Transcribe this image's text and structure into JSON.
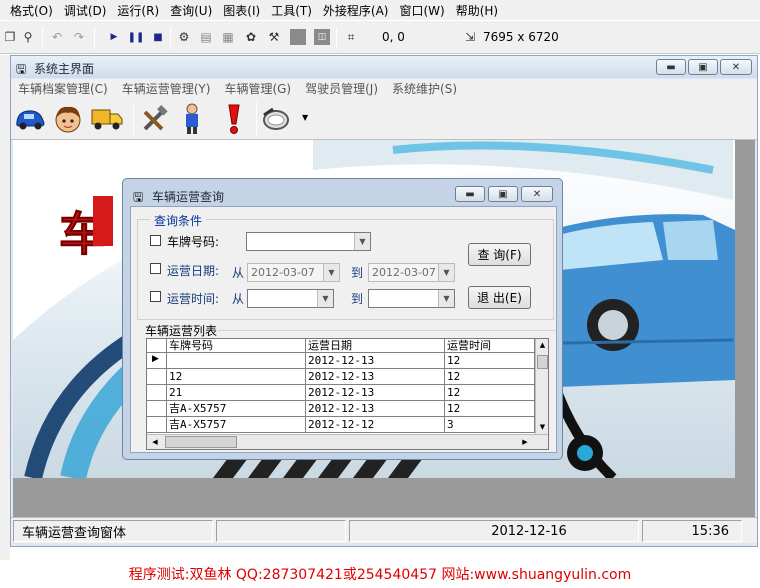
{
  "ide_menu": [
    "格式(O)",
    "调试(D)",
    "运行(R)",
    "查询(U)",
    "图表(I)",
    "工具(T)",
    "外接程序(A)",
    "窗口(W)",
    "帮助(H)"
  ],
  "ide_toolbar": {
    "coords": "0, 0",
    "dims": "7695 x 6720"
  },
  "main_window": {
    "title": "系统主界面",
    "menu": [
      "车辆档案管理(C)",
      "车辆运营管理(Y)",
      "车辆管理(G)",
      "驾驶员管理(J)",
      "系统维护(S)"
    ],
    "toolbar_icons": [
      "car-icon",
      "driver-face-icon",
      "truck-icon",
      "tools-icon",
      "person-icon",
      "alert-icon",
      "search-magnifier-icon"
    ],
    "banner_text": "车"
  },
  "dialog": {
    "title": "车辆运营查询",
    "condition_group": "查询条件",
    "plate_label": "车牌号码:",
    "date_label": "运营日期:",
    "time_label": "运营时间:",
    "from_label": "从",
    "to_label": "到",
    "date_from": "2012-03-07",
    "date_to": "2012-03-07",
    "query_button": "查 询(F)",
    "exit_button": "退 出(E)",
    "list_group": "车辆运营列表",
    "columns": [
      "车牌号码",
      "运营日期",
      "运营时间"
    ],
    "rows": [
      [
        "",
        "2012-12-13",
        "12"
      ],
      [
        "12",
        "2012-12-13",
        "12"
      ],
      [
        "21",
        "2012-12-13",
        "12"
      ],
      [
        "吉A-X5757",
        "2012-12-13",
        "12"
      ],
      [
        "吉A-X5757",
        "2012-12-12",
        "3"
      ]
    ]
  },
  "status_bar": {
    "form_name": "车辆运营查询窗体",
    "date": "2012-12-16",
    "time": "15:36"
  },
  "watermark": "程序测试:双鱼林 QQ:287307421或254540457 网站:www.shuangyulin.com",
  "colors": {
    "title_bar": "#cfdcec",
    "dialog_frame": "#c4d3e6",
    "watermark": "#e00000",
    "banner_red": "#d41a1a"
  }
}
